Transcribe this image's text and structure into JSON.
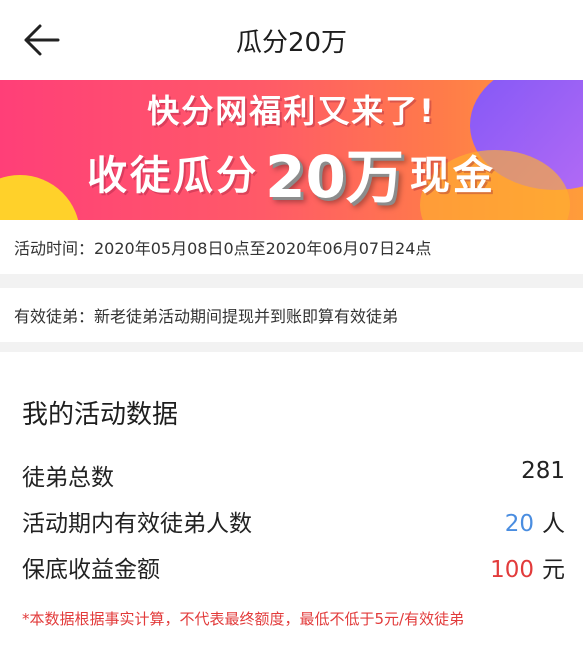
{
  "header": {
    "title": "瓜分20万"
  },
  "banner": {
    "line1": "快分网福利又来了!",
    "line2_prefix": "收徒瓜分",
    "line2_amount": "20万",
    "line2_suffix": "现金"
  },
  "activity_time": "活动时间：2020年05月08日0点至2020年06月07日24点",
  "valid_disciple": "有效徒弟：新老徒弟活动期间提现并到账即算有效徒弟",
  "my_data": {
    "title": "我的活动数据",
    "rows": [
      {
        "label": "徒弟总数",
        "value": "281",
        "unit": ""
      },
      {
        "label": "活动期内有效徒弟人数",
        "value": "20",
        "unit": "人"
      },
      {
        "label": "保底收益金额",
        "value": "100",
        "unit": "元"
      }
    ],
    "note": "*本数据根据事实计算，不代表最终额度，最低不低于5元/有效徒弟"
  },
  "colors": {
    "blue_value": "#4a8de0",
    "red_value": "#e23b3b",
    "note_red": "#e23b3b",
    "banner_pink": "#ff3f78",
    "banner_orange": "#ff9d3a"
  },
  "icons": {
    "back": "arrow-left-icon"
  }
}
